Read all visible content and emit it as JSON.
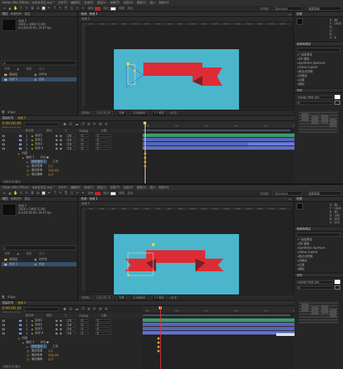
{
  "screenshots": [
    {
      "menu": [
        "Adobe After Effects - 未命名项目.aep *",
        "文件(F)",
        "编辑(E)",
        "合成(C)",
        "图层(L)",
        "效果(T)",
        "动画(A)",
        "视图(V)",
        "窗口",
        "帮助(H)"
      ],
      "toolbar": {
        "align_label": "对齐",
        "stroke_label": "描边",
        "px_label": "像素",
        "add_label": "添加",
        "workspace_label": "工作区：",
        "workspace_value": "Standard",
        "search_placeholder": "搜索帮助",
        "fill_color": "#c4242a",
        "stroke_color": "#ffffff"
      },
      "project": {
        "tabs": [
          "项目",
          "效果控件",
          "图层"
        ],
        "comp_name": "合成 1",
        "comp_info": [
          "1920 x 1080 (1.00)",
          "Δ 0;00;05;00, 29.97 fps"
        ],
        "search_placeholder": "ρ",
        "cols": [
          "名称",
          "▲",
          "类型",
          "大小"
        ],
        "items": [
          {
            "name": "固态层",
            "type": "文件夹",
            "size": "",
            "selected": false
          },
          {
            "name": "合成 1",
            "type": "合成",
            "size": "",
            "selected": true
          }
        ],
        "footer": "8 bpc"
      },
      "comp": {
        "tab": "合成：合成 1",
        "sub": "合成 1",
        "ruler_ticks": [
          "100",
          "200",
          "300",
          "400",
          "500",
          "600",
          "700",
          "800",
          "900",
          "1000",
          "1100",
          "1200",
          "1300",
          "1400",
          "1500",
          "1600",
          "1700",
          "1800"
        ],
        "canvas_color": "#4bb5cb",
        "ribbon_color": "#dd2c35",
        "ribbon_dark": "#7a1f24",
        "viewbar": [
          "(50%)",
          "0;00;00;00",
          "完整",
          "活动摄像机",
          "1个视图",
          "+0.0"
        ]
      },
      "info": {
        "title": "信息",
        "x_label": "X : 84",
        "y_label": "Y : 1920",
        "r_label": "R :",
        "g_label": "G :",
        "b_label": "B :",
        "a_label": "A : 0"
      },
      "effects": {
        "title": "效果和预设",
        "items": [
          "* 动画预设",
          "3D 通道",
          "Synthetic Aperture",
          "Video Copilot",
          "表达式控制",
          "风格化",
          "过渡",
          "模拟"
        ]
      },
      "character": {
        "title": "字符",
        "font": "Adobe 黑体 Std",
        "style": "R"
      },
      "timeline": {
        "tab_render": "渲染队列",
        "tab_comp": "合成 1",
        "time": "0;00;00;00",
        "fps": "00000 (29.97 fps)",
        "cols": [
          "源名称",
          "模式",
          "T",
          "TrkMat",
          "父级"
        ],
        "layers": [
          {
            "num": "1",
            "name": "形状1",
            "color": "#6a8ad8",
            "mode": "正常",
            "trk": "无",
            "parent": "无"
          },
          {
            "num": "2",
            "name": "形状2",
            "color": "#6a8ad8",
            "mode": "正常",
            "trk": "无",
            "parent": "无"
          },
          {
            "num": "3",
            "name": "形状3",
            "color": "#6a8ad8",
            "mode": "正常",
            "trk": "无",
            "parent": "无"
          },
          {
            "num": "4",
            "name": "形状 4",
            "color": "#6a8ad8",
            "mode": "正常",
            "trk": "无",
            "parent": "无"
          }
        ],
        "props": [
          {
            "name": "内容",
            "value": "",
            "indent": 1
          },
          {
            "name": "路径 1",
            "value": "添加 ●",
            "indent": 2
          },
          {
            "name": "修剪路径 1",
            "value": "正常",
            "indent": 3
          },
          {
            "name": "描边宽度",
            "value": "2.0",
            "indent": 3
          },
          {
            "name": "描边结束",
            "value": "100.0%",
            "indent": 3
          },
          {
            "name": "描边偏移",
            "value": "0.0°",
            "indent": 3
          }
        ],
        "ruler_ticks": [
          "00s",
          "01s",
          "02s",
          "03s",
          "04s",
          "05s"
        ],
        "footer": "切换开关/模式"
      }
    },
    {
      "menu": [
        "Adobe After Effects - 未命名项目.aep *",
        "文件(F)",
        "编辑(E)",
        "合成(C)",
        "图层(L)",
        "效果(T)",
        "动画(A)",
        "视图(V)",
        "窗口",
        "帮助(H)"
      ],
      "toolbar": {
        "align_label": "对齐",
        "stroke_label": "描边",
        "px_label": "像素",
        "add_label": "添加",
        "workspace_label": "工作区：",
        "workspace_value": "Standard",
        "search_placeholder": "搜索帮助",
        "fill_color": "#c4242a",
        "stroke_color": "#ffffff"
      },
      "project": {
        "tabs": [
          "项目",
          "效果控件",
          "图层"
        ],
        "comp_name": "合成 1",
        "comp_info": [
          "1920 x 1080 (1.00)",
          "Δ 0;00;05;00, 29.97 fps"
        ],
        "search_placeholder": "ρ",
        "cols": [
          "名称",
          "▲",
          "类型",
          "大小"
        ],
        "items": [
          {
            "name": "固态层",
            "type": "文件夹",
            "size": "",
            "selected": false
          },
          {
            "name": "合成 1",
            "type": "合成",
            "size": "",
            "selected": true
          }
        ],
        "footer": "8 bpc"
      },
      "comp": {
        "tab": "合成：合成 1",
        "sub": "合成 1",
        "ruler_ticks": [
          "100",
          "200",
          "300",
          "400",
          "500",
          "600",
          "700",
          "800",
          "900",
          "1000",
          "1100",
          "1200",
          "1300",
          "1400",
          "1500",
          "1600",
          "1700",
          "1800"
        ],
        "canvas_color": "#4bb5cb",
        "ribbon_color": "#dd2c35",
        "ribbon_dark": "#7a1f24",
        "viewbar": [
          "(50%)",
          "0;00;00;16",
          "完整",
          "活动摄像机",
          "1个视图",
          "+0.0"
        ]
      },
      "info": {
        "title": "信息",
        "x_label": "X : 84",
        "y_label": "Y : 1920",
        "r_label": "R : 96",
        "g_label": "G : 185",
        "b_label": "B : 205",
        "a_label": "A : 255"
      },
      "effects": {
        "title": "效果和预设",
        "items": [
          "* 动画预设",
          "3D 通道",
          "Synthetic Aperture",
          "Video Copilot",
          "表达式控制",
          "风格化",
          "过渡",
          "模拟"
        ]
      },
      "character": {
        "title": "字符",
        "font": "Adobe 黑体 Std",
        "style": "R"
      },
      "timeline": {
        "tab_render": "渲染队列",
        "tab_comp": "合成 1",
        "time": "0;00;00;16",
        "fps": "00016 (29.97 fps)",
        "cols": [
          "源名称",
          "模式",
          "T",
          "TrkMat",
          "父级"
        ],
        "layers": [
          {
            "num": "1",
            "name": "形状1",
            "color": "#6a8ad8",
            "mode": "正常",
            "trk": "无",
            "parent": "无"
          },
          {
            "num": "2",
            "name": "形状2",
            "color": "#6a8ad8",
            "mode": "正常",
            "trk": "无",
            "parent": "无"
          },
          {
            "num": "3",
            "name": "形状3",
            "color": "#6a8ad8",
            "mode": "正常",
            "trk": "无",
            "parent": "无"
          },
          {
            "num": "4",
            "name": "形状 4",
            "color": "#6a8ad8",
            "mode": "正常",
            "trk": "无",
            "parent": "无"
          }
        ],
        "props": [
          {
            "name": "内容",
            "value": "",
            "indent": 1
          },
          {
            "name": "路径 1",
            "value": "添加 ●",
            "indent": 2
          },
          {
            "name": "修剪路径 1",
            "value": "正常",
            "indent": 3
          },
          {
            "name": "描边宽度",
            "value": "2.0",
            "indent": 3
          },
          {
            "name": "描边结束",
            "value": "100.0%",
            "indent": 3
          },
          {
            "name": "描边偏移",
            "value": "0.0°",
            "indent": 3
          }
        ],
        "ruler_ticks": [
          "00s",
          "01s",
          "02s",
          "03s",
          "04s",
          "05s"
        ],
        "footer": "切换开关/模式"
      }
    }
  ]
}
